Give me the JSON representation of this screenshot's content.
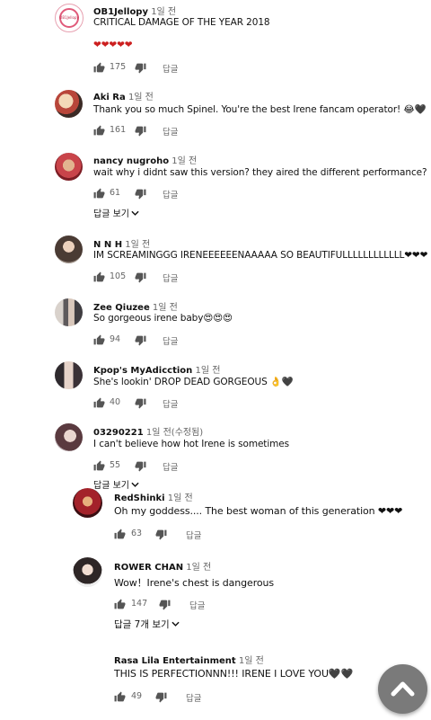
{
  "comments": [
    {
      "author": "OB1Jellopy",
      "time": "1일 전",
      "text": "CRITICAL DAMAGE OF THE YEAR 2018",
      "line2": "❤❤❤❤❤",
      "likes": "175",
      "reply_label": "답글",
      "avatar_text": "OB1Jellopy"
    },
    {
      "author": "Aki Ra",
      "time": "1일 전",
      "text": "Thank you so much Spinel. You're the best Irene fancam operator! 😂🖤",
      "likes": "161",
      "reply_label": "답글"
    },
    {
      "author": "nancy nugroho",
      "time": "1일 전",
      "text": "wait why i didnt saw this version? they aired the different performance?",
      "likes": "61",
      "reply_label": "답글",
      "view_replies": "답글 보기"
    },
    {
      "author": "N N H",
      "time": "1일 전",
      "text": "IM SCREAMINGGG IRENEEEEEENAAAAA SO BEAUTIFULLLLLLLLLLLL❤❤❤",
      "likes": "105",
      "reply_label": "답글"
    },
    {
      "author": "Zee Qiuzee",
      "time": "1일 전",
      "text": "So gorgeous irene baby😍😍😍",
      "likes": "94",
      "reply_label": "답글"
    },
    {
      "author": "Kpop's MyAdicction",
      "time": "1일 전",
      "text": "She's lookin' DROP DEAD GORGEOUS 👌🖤",
      "likes": "40",
      "reply_label": "답글"
    },
    {
      "author": "03290221",
      "time": "1일 전(수정됨)",
      "text": "I can't believe how hot Irene is sometimes",
      "likes": "55",
      "reply_label": "답글",
      "view_replies": "답글 보기"
    }
  ],
  "replies": [
    {
      "author": "RedShinki",
      "time": "1일 전",
      "text": "Oh my goddess.... The best woman of this generation ❤❤❤",
      "likes": "63",
      "reply_label": "답글"
    },
    {
      "author": "ROWER CHAN",
      "time": "1일 전",
      "text": "Wow！Irene's chest is dangerous",
      "likes": "147",
      "reply_label": "답글",
      "view_replies": "답글 7개 보기"
    },
    {
      "author": "Rasa Lila Entertainment",
      "time": "1일 전",
      "text": "THIS IS PERFECTIONNN!!! IRENE I LOVE YOU🖤🖤",
      "likes": "49",
      "reply_label": "답글"
    }
  ],
  "colors": {
    "meta": "#666666",
    "fab": "#7a7a7a",
    "heart": "#cc1f1f"
  },
  "icons": {
    "like": "thumbs-up-icon",
    "dislike": "thumbs-down-icon",
    "expand": "chevron-down-icon",
    "fab": "chevron-up-icon"
  }
}
